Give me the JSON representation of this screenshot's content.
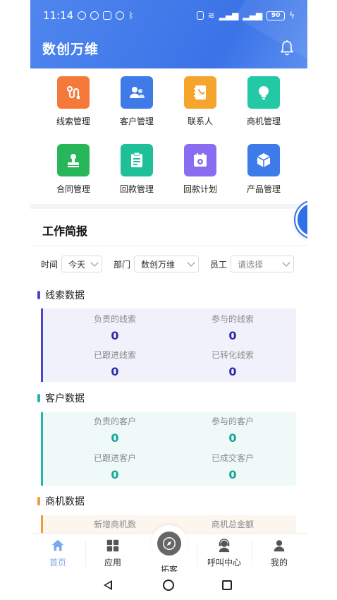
{
  "status_bar": {
    "time": "11:14",
    "battery": "90"
  },
  "header": {
    "title": "数创万维"
  },
  "quick_menu": [
    {
      "label": "线索管理",
      "icon": "route-icon",
      "color": "#f5793a"
    },
    {
      "label": "客户管理",
      "icon": "users-icon",
      "color": "#3e7be9"
    },
    {
      "label": "联系人",
      "icon": "contact-book-icon",
      "color": "#f5a52c"
    },
    {
      "label": "商机管理",
      "icon": "lightbulb-icon",
      "color": "#22c9a4"
    },
    {
      "label": "合同管理",
      "icon": "stamp-icon",
      "color": "#27b65a"
    },
    {
      "label": "回款管理",
      "icon": "clipboard-icon",
      "color": "#1fbf9a"
    },
    {
      "label": "回款计划",
      "icon": "calendar-gear-icon",
      "color": "#8a6cf0"
    },
    {
      "label": "产品管理",
      "icon": "box-icon",
      "color": "#3e7be9"
    }
  ],
  "report": {
    "title": "工作简报",
    "filters": {
      "time_label": "时间",
      "time_value": "今天",
      "dept_label": "部门",
      "dept_value": "数创万维",
      "staff_label": "员工",
      "staff_placeholder": "请选择"
    },
    "sections": [
      {
        "title": "线索数据",
        "accent": "#4a47c9",
        "card_bg": "#f1f1fb",
        "value_color": "#2e2ba8",
        "stats": [
          {
            "label": "负责的线索",
            "value": "0"
          },
          {
            "label": "参与的线索",
            "value": "0"
          },
          {
            "label": "已跟进线索",
            "value": "0"
          },
          {
            "label": "已转化线索",
            "value": "0"
          }
        ]
      },
      {
        "title": "客户数据",
        "accent": "#22b7a4",
        "card_bg": "#eef9f8",
        "value_color": "#14a596",
        "stats": [
          {
            "label": "负责的客户",
            "value": "0"
          },
          {
            "label": "参与的客户",
            "value": "0"
          },
          {
            "label": "已跟进客户",
            "value": "0"
          },
          {
            "label": "已成交客户",
            "value": "0"
          }
        ]
      },
      {
        "title": "商机数据",
        "accent": "#f29a3d",
        "card_bg": "#fdf6ee",
        "value_color": "#e08a2c",
        "stats": [
          {
            "label": "新增商机数",
            "value": ""
          },
          {
            "label": "商机总金额",
            "value": ""
          }
        ]
      }
    ]
  },
  "tabbar": {
    "home": "首页",
    "apps": "应用",
    "explore": "拓客",
    "call_center": "呼叫中心",
    "mine": "我的"
  }
}
